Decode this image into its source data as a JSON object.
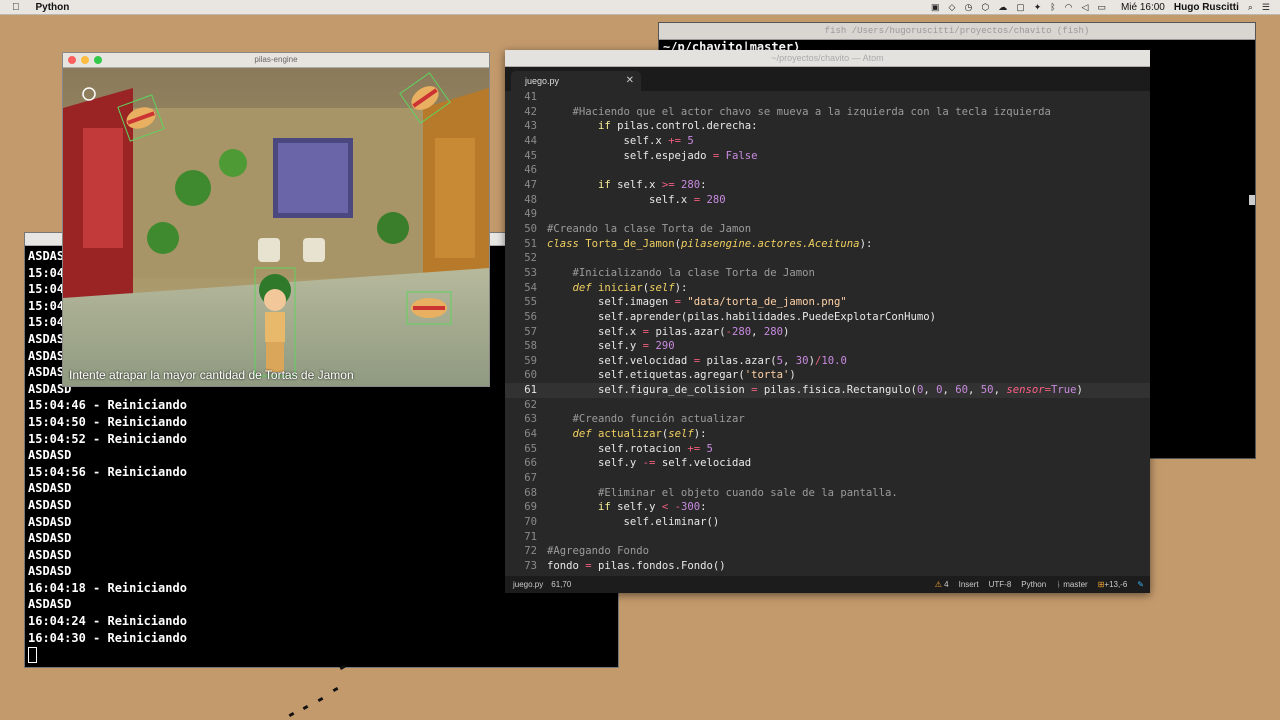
{
  "menubar": {
    "app": "Python",
    "clock": "Mié 16:00",
    "user": "Hugo Ruscitti"
  },
  "term_top": {
    "title": "fish /Users/hugoruscitti/proyectos/chavito (fish)",
    "prompt": "~/p/chavito|master⟩"
  },
  "game": {
    "title": "pilas-engine",
    "caption": "Intente atrapar la mayor cantidad de Tortas de Jamon"
  },
  "editor": {
    "title": "~/proyectos/chavito — Atom",
    "tab": "juego.py",
    "status": {
      "file": "juego.py",
      "position": "61,70",
      "warnings": "4",
      "mode": "Insert",
      "encoding": "UTF-8",
      "grammar": "Python",
      "branch": "master",
      "diff": "+13,-6"
    },
    "lines": [
      {
        "n": "41",
        "t": []
      },
      {
        "n": "42",
        "t": [
          [
            "cm",
            "    #Haciendo que el actor chavo se mueva a la izquierda con la tecla izquierda"
          ]
        ]
      },
      {
        "n": "43",
        "t": [
          [
            "tx",
            "        "
          ],
          [
            "kw",
            "if"
          ],
          [
            "tx",
            " pilas.control.derecha:"
          ]
        ]
      },
      {
        "n": "44",
        "t": [
          [
            "tx",
            "            self.x "
          ],
          [
            "op",
            "+="
          ],
          [
            "tx",
            " "
          ],
          [
            "nu",
            "5"
          ]
        ]
      },
      {
        "n": "45",
        "t": [
          [
            "tx",
            "            self.espejado "
          ],
          [
            "op",
            "="
          ],
          [
            "tx",
            " "
          ],
          [
            "bo",
            "False"
          ]
        ]
      },
      {
        "n": "46",
        "t": []
      },
      {
        "n": "47",
        "t": [
          [
            "tx",
            "        "
          ],
          [
            "kw",
            "if"
          ],
          [
            "tx",
            " self.x "
          ],
          [
            "op",
            ">="
          ],
          [
            "tx",
            " "
          ],
          [
            "nu",
            "280"
          ],
          [
            "tx",
            ":"
          ]
        ]
      },
      {
        "n": "48",
        "t": [
          [
            "tx",
            "                self.x "
          ],
          [
            "op",
            "="
          ],
          [
            "tx",
            " "
          ],
          [
            "nu",
            "280"
          ]
        ]
      },
      {
        "n": "49",
        "t": []
      },
      {
        "n": "50",
        "t": [
          [
            "cm",
            "#Creando la clase Torta de Jamon"
          ]
        ]
      },
      {
        "n": "51",
        "t": [
          [
            "it",
            "class"
          ],
          [
            "tx",
            " "
          ],
          [
            "cl",
            "Torta_de_Jamon"
          ],
          [
            "tx",
            "("
          ],
          [
            "it",
            "pilasengine.actores.Aceituna"
          ],
          [
            "tx",
            "):"
          ]
        ]
      },
      {
        "n": "52",
        "t": []
      },
      {
        "n": "53",
        "t": [
          [
            "cm",
            "    #Inicializando la clase Torta de Jamon"
          ]
        ]
      },
      {
        "n": "54",
        "t": [
          [
            "tx",
            "    "
          ],
          [
            "it",
            "def"
          ],
          [
            "tx",
            " "
          ],
          [
            "fn",
            "iniciar"
          ],
          [
            "tx",
            "("
          ],
          [
            "sf",
            "self"
          ],
          [
            "tx",
            "):"
          ]
        ]
      },
      {
        "n": "55",
        "t": [
          [
            "tx",
            "        self.imagen "
          ],
          [
            "op",
            "="
          ],
          [
            "tx",
            " "
          ],
          [
            "st",
            "\"data/torta_de_jamon.png\""
          ]
        ]
      },
      {
        "n": "56",
        "t": [
          [
            "tx",
            "        self.aprender(pilas.habilidades.PuedeExplotarConHumo)"
          ]
        ]
      },
      {
        "n": "57",
        "t": [
          [
            "tx",
            "        self.x "
          ],
          [
            "op",
            "="
          ],
          [
            "tx",
            " pilas.azar("
          ],
          [
            "op",
            "-"
          ],
          [
            "nu",
            "280"
          ],
          [
            "tx",
            ", "
          ],
          [
            "nu",
            "280"
          ],
          [
            "tx",
            ")"
          ]
        ]
      },
      {
        "n": "58",
        "t": [
          [
            "tx",
            "        self.y "
          ],
          [
            "op",
            "="
          ],
          [
            "tx",
            " "
          ],
          [
            "nu",
            "290"
          ]
        ]
      },
      {
        "n": "59",
        "t": [
          [
            "tx",
            "        self.velocidad "
          ],
          [
            "op",
            "="
          ],
          [
            "tx",
            " pilas.azar("
          ],
          [
            "nu",
            "5"
          ],
          [
            "tx",
            ", "
          ],
          [
            "nu",
            "30"
          ],
          [
            "tx",
            ")"
          ],
          [
            "op",
            "/"
          ],
          [
            "nu",
            "10.0"
          ]
        ]
      },
      {
        "n": "60",
        "t": [
          [
            "tx",
            "        self.etiquetas.agregar("
          ],
          [
            "st",
            "'torta'"
          ],
          [
            "tx",
            ")"
          ]
        ]
      },
      {
        "n": "61",
        "cur": true,
        "t": [
          [
            "tx",
            "        self.figura_de_colision "
          ],
          [
            "op",
            "="
          ],
          [
            "tx",
            " pilas.fisica.Rectangulo("
          ],
          [
            "nu",
            "0"
          ],
          [
            "tx",
            ", "
          ],
          [
            "nu",
            "0"
          ],
          [
            "tx",
            ", "
          ],
          [
            "nu",
            "60"
          ],
          [
            "tx",
            ", "
          ],
          [
            "nu",
            "50"
          ],
          [
            "tx",
            ", "
          ],
          [
            "pr",
            "sensor"
          ],
          [
            "op",
            "="
          ],
          [
            "bo",
            "True"
          ],
          [
            "tx",
            ")"
          ]
        ]
      },
      {
        "n": "62",
        "t": []
      },
      {
        "n": "63",
        "t": [
          [
            "cm",
            "    #Creando función actualizar"
          ]
        ]
      },
      {
        "n": "64",
        "t": [
          [
            "tx",
            "    "
          ],
          [
            "it",
            "def"
          ],
          [
            "tx",
            " "
          ],
          [
            "fn",
            "actualizar"
          ],
          [
            "tx",
            "("
          ],
          [
            "sf",
            "self"
          ],
          [
            "tx",
            "):"
          ]
        ]
      },
      {
        "n": "65",
        "t": [
          [
            "tx",
            "        self.rotacion "
          ],
          [
            "op",
            "+="
          ],
          [
            "tx",
            " "
          ],
          [
            "nu",
            "5"
          ]
        ]
      },
      {
        "n": "66",
        "t": [
          [
            "tx",
            "        self.y "
          ],
          [
            "op",
            "-="
          ],
          [
            "tx",
            " self.velocidad"
          ]
        ]
      },
      {
        "n": "67",
        "t": []
      },
      {
        "n": "68",
        "t": [
          [
            "cm",
            "        #Eliminar el objeto cuando sale de la pantalla."
          ]
        ]
      },
      {
        "n": "69",
        "t": [
          [
            "tx",
            "        "
          ],
          [
            "kw",
            "if"
          ],
          [
            "tx",
            " self.y "
          ],
          [
            "op",
            "<"
          ],
          [
            "tx",
            " "
          ],
          [
            "op",
            "-"
          ],
          [
            "nu",
            "300"
          ],
          [
            "tx",
            ":"
          ]
        ]
      },
      {
        "n": "70",
        "t": [
          [
            "tx",
            "            self.eliminar()"
          ]
        ]
      },
      {
        "n": "71",
        "t": []
      },
      {
        "n": "72",
        "t": [
          [
            "cm",
            "#Agregando Fondo"
          ]
        ]
      },
      {
        "n": "73",
        "t": [
          [
            "tx",
            "fondo "
          ],
          [
            "op",
            "="
          ],
          [
            "tx",
            " pilas.fondos.Fondo()"
          ]
        ]
      }
    ]
  },
  "term_left": {
    "lines": [
      "ASDASD",
      "15:04:",
      "15:04:",
      "15:04:",
      "15:04:",
      "ASDASD",
      "ASDASD",
      "ASDASD",
      "ASDASD",
      "15:04:46 - Reiniciando",
      "15:04:50 - Reiniciando",
      "15:04:52 - Reiniciando",
      "ASDASD",
      "15:04:56 - Reiniciando",
      "ASDASD",
      "ASDASD",
      "ASDASD",
      "ASDASD",
      "ASDASD",
      "ASDASD",
      "16:04:18 - Reiniciando",
      "ASDASD",
      "16:04:24 - Reiniciando",
      "16:04:30 - Reiniciando"
    ]
  }
}
